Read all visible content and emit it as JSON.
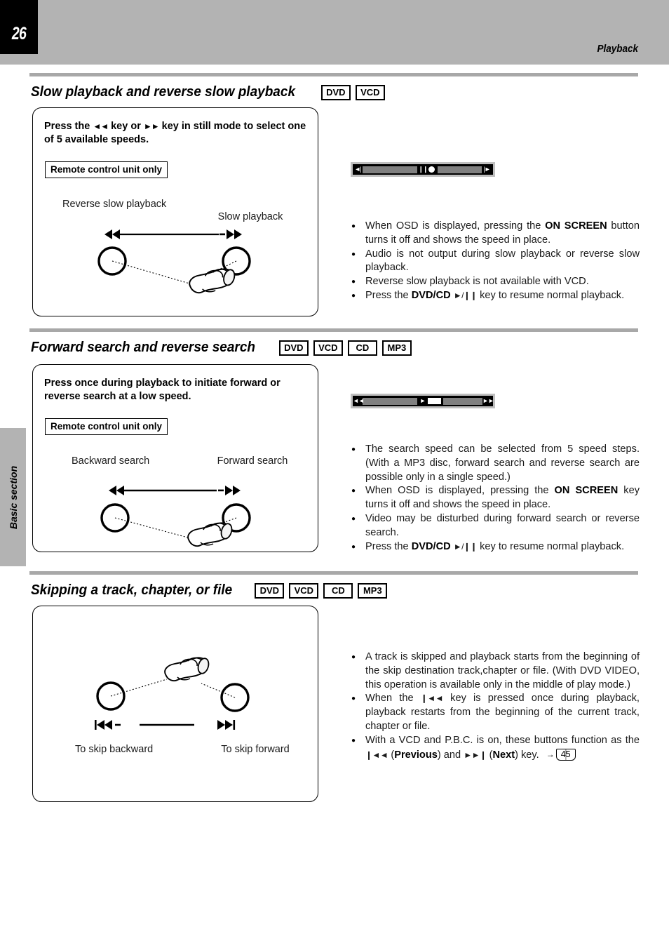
{
  "header": {
    "page_number": "26",
    "title": "Playback"
  },
  "side_tab": {
    "label": "Basic section"
  },
  "sections": [
    {
      "id": "slow-playback",
      "title": "Slow playback and reverse slow playback",
      "badges": [
        "DVD",
        "VCD"
      ],
      "instruction": "Press the ◄◄ key or ►► key in still mode to select one of 5 available speeds.",
      "remote_note": "Remote control unit only",
      "diagram": {
        "left_label": "Reverse slow playback",
        "right_label": "Slow playback",
        "left_key": "◄◄",
        "right_key": "–►►"
      },
      "osd": {
        "left_glyph": "◄|",
        "right_glyph": "|►",
        "mid_glyph": "❙❙",
        "marker": "dot"
      },
      "bullets": [
        "When OSD is displayed, pressing the ON SCREEN button turns it off and shows the speed in place.",
        "Audio is not output during slow playback or reverse slow playback.",
        "Reverse slow playback is not available with VCD.",
        "Press the DVD/CD ►/❙❙ key to resume normal playback."
      ]
    },
    {
      "id": "forward-search",
      "title": "Forward search and reverse search",
      "badges": [
        "DVD",
        "VCD",
        "CD",
        "MP3"
      ],
      "instruction": "Press once during playback to initiate forward or reverse search at a low speed.",
      "remote_note": "Remote control unit only",
      "diagram": {
        "left_label": "Backward search",
        "right_label": "Forward search",
        "left_key": "◄◄",
        "right_key": "–►►"
      },
      "osd": {
        "left_glyph": "◄◄",
        "right_glyph": "►►",
        "mid_glyph": "►",
        "marker": "rect"
      },
      "bullets": [
        "The search speed can be selected from 5 speed steps. (With a MP3 disc, forward search and reverse search are possible only in a single speed.)",
        "When OSD is displayed, pressing the ON SCREEN key turns it off and shows the speed in place.",
        "Video may be disturbed during forward search or reverse search.",
        "Press the DVD/CD ►/❙❙ key to resume normal playback."
      ]
    },
    {
      "id": "skipping",
      "title": "Skipping a track, chapter, or file",
      "badges": [
        "DVD",
        "VCD",
        "CD",
        "MP3"
      ],
      "diagram": {
        "left_label": "To skip backward",
        "right_label": "To skip forward",
        "left_key": "|◄◄ –",
        "right_key": "►►|"
      },
      "bullets": [
        "A track is skipped and playback starts from the beginning of the skip destination track,chapter or file. (With DVD VIDEO, this operation is available only in the middle of play mode.)",
        "When the |◄◄ key is pressed once during playback, playback restarts from the beginning of the current track, chapter or file.",
        "With a VCD and P.B.C. is on, these buttons function as the |◄◄ (Previous) and ►►| (Next) key.",
        ""
      ],
      "page_reference": {
        "arrow": "→",
        "page": "45"
      }
    }
  ],
  "rich_text": {
    "s0_instr_a": "Press the ",
    "s0_instr_b": " key or ",
    "s0_instr_c": " key in still mode to select one of 5 available speeds.",
    "s1_instr": "Press once during playback to initiate forward or reverse search at a low speed."
  },
  "colors": {
    "header_bg": "#b3b3b3",
    "divider": "#a8a8a8",
    "page_block": "#000000",
    "osd_frame": "#bfbfbf",
    "osd_track": "#000000",
    "osd_segment": "#808080",
    "text": "#1a1a1a"
  }
}
